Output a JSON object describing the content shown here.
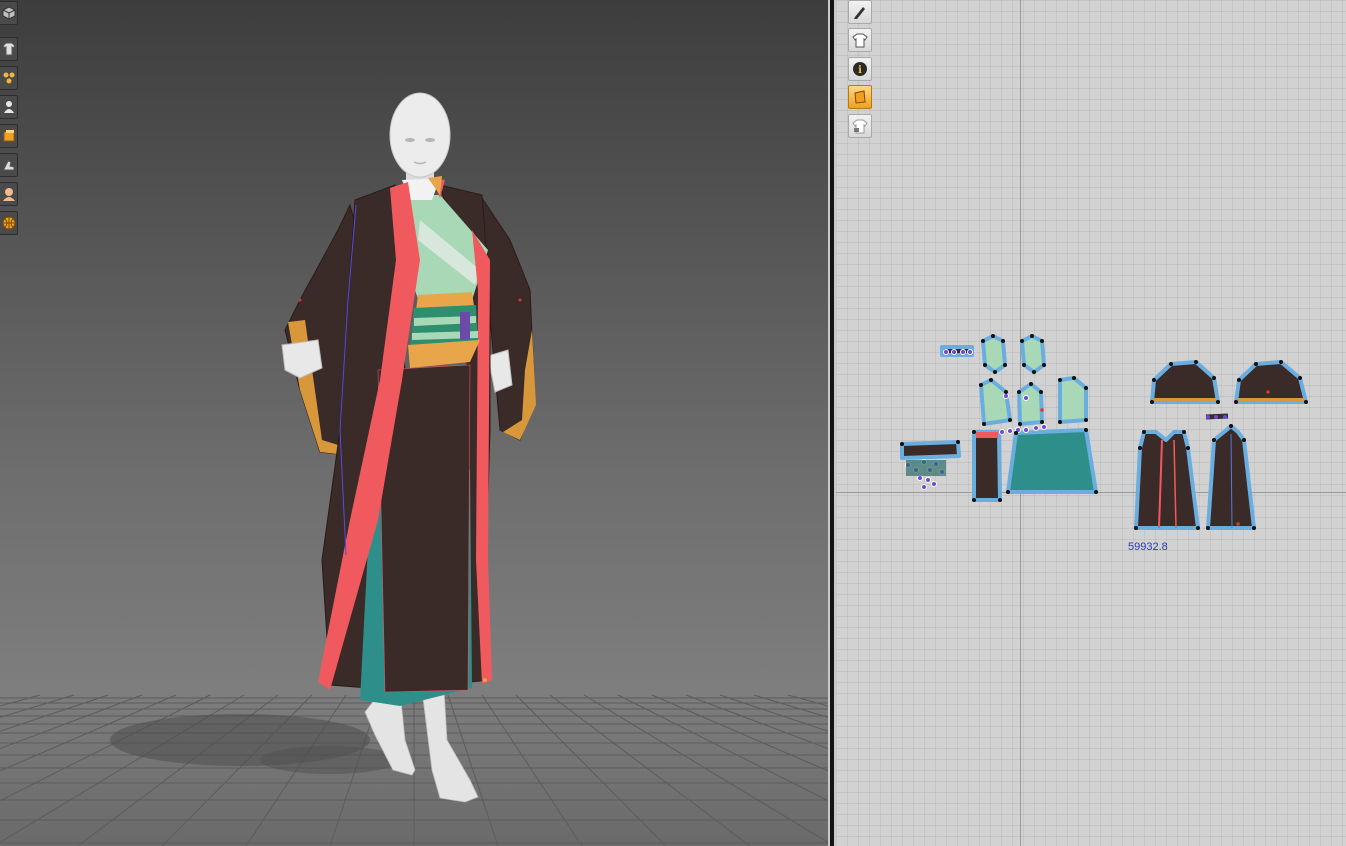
{
  "viewport_3d": {
    "toolbar": [
      {
        "icon": "cube-view-icon"
      },
      {
        "icon": "garment-display-icon"
      },
      {
        "icon": "points-display-icon"
      },
      {
        "icon": "avatar-display-icon"
      },
      {
        "icon": "texture-display-icon"
      },
      {
        "icon": "shoe-display-icon"
      },
      {
        "icon": "skin-display-icon"
      },
      {
        "icon": "globe-environment-icon"
      }
    ]
  },
  "pattern_2d": {
    "toolbar": [
      {
        "icon": "pen-edit-icon"
      },
      {
        "icon": "shirt-display-icon"
      },
      {
        "icon": "info-icon"
      },
      {
        "icon": "texture-icon"
      },
      {
        "icon": "locked-shirt-icon"
      }
    ],
    "measure_label": "59932.8"
  },
  "colors": {
    "robe_dark": "#3a2a28",
    "trim_coral": "#f05a5e",
    "sleeve_cuff": "#d7973a",
    "inner_mint": "#a9d8b6",
    "skirt_teal": "#2e8f8a",
    "sash_orange": "#e8a54a",
    "pattern_outline": "#6aaee0",
    "seam_purple": "#6b4ad8"
  }
}
